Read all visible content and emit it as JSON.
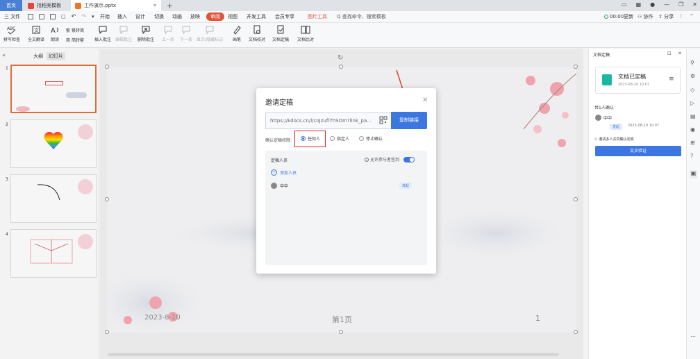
{
  "titlebar": {
    "home_tab": "首页",
    "tabs": [
      {
        "label": "找稻壳模板",
        "icon": "docer-icon",
        "color": "#e8433d"
      },
      {
        "label": "工作演示.pptx",
        "icon": "ppt-file-icon",
        "color": "#f0742a"
      }
    ],
    "add_tab": "+"
  },
  "menubar": {
    "file": "三 文件",
    "items": [
      "开始",
      "插入",
      "设计",
      "切换",
      "动画",
      "放映",
      "审阅",
      "视图",
      "开发工具",
      "会员专享"
    ],
    "active": "审阅",
    "picture_tools": "图片工具",
    "search": "Q 查找命令、搜索模板",
    "sync": "00:00更新",
    "collab": "协作",
    "share": "分享"
  },
  "ribbon": {
    "spell_check": "拼写检查",
    "full_translate": "全文翻译",
    "read_aloud": "朗读",
    "simplified": "繁转简",
    "traditional": "简转繁",
    "insert_comment": "插入批注",
    "edit_comment": "编辑批注",
    "delete_comment": "删除批注",
    "prev": "上一条",
    "next": "下一条",
    "show_hide": "显示/隐藏标记",
    "ink": "画笔",
    "doc_check": "文档校对",
    "doc_finalize": "文档定稿",
    "doc_compare": "文档比对"
  },
  "leftpanel": {
    "view_tabs": [
      "大纲",
      "幻灯片"
    ],
    "active_view": "幻灯片",
    "slides": [
      "1",
      "2",
      "3",
      "4"
    ]
  },
  "slide": {
    "date": "2023-8-10",
    "page": "第1页",
    "number": "1"
  },
  "dialog": {
    "title": "邀请定稿",
    "link": "https://kdocs.cn/l/coJzufl7hSOm?link_pa...",
    "copy_btn": "复制链接",
    "permission_label": "确认定稿权限:",
    "options": [
      "任何人",
      "指定人",
      "停止确认"
    ],
    "selected_option": "任何人",
    "reviewers_label": "定稿人员",
    "allow_label": "允许参与者签到",
    "add_people": "添加人员",
    "reviewer_name": "中中",
    "reviewer_tag": "发起"
  },
  "rightpanel": {
    "title": "文档定稿",
    "status_title": "文档已定稿",
    "status_time": "2023-08-10 10:07",
    "count_label": "共1人确认",
    "person_name": "中中",
    "person_tag": "发起",
    "person_time": "2023-08-10 10:07",
    "multi_note": "邀请多人共同确认定稿",
    "cancel_btn": "交叉验证"
  },
  "colors": {
    "accent": "#3b76e1",
    "review_tab": "#e0543a",
    "highlight": "#e02020",
    "slide_selected": "#e36b3c"
  }
}
